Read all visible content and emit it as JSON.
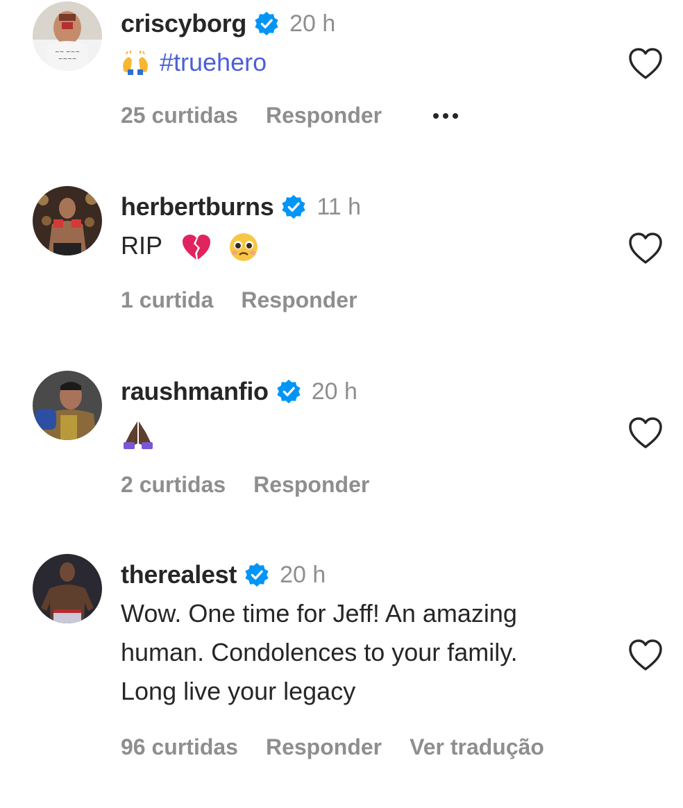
{
  "comments": [
    {
      "username": "criscyborg",
      "time": "20 h",
      "hashtag": "#truehero",
      "emoji": "raising-hands-emoji",
      "likes": "25 curtidas",
      "reply": "Responder",
      "more": "more-options"
    },
    {
      "username": "herbertburns",
      "time": "11 h",
      "text": "RIP",
      "emoji": [
        "broken-heart-emoji",
        "pleading-face-emoji"
      ],
      "likes": "1 curtida",
      "reply": "Responder"
    },
    {
      "username": "raushmanfio",
      "time": "20 h",
      "emoji": "folded-hands-emoji",
      "likes": "2 curtidas",
      "reply": "Responder"
    },
    {
      "username": "therealest",
      "time": "20 h",
      "text_lines": [
        "Wow. One time for Jeff! An amazing",
        "human. Condolences to your family.",
        "Long live your legacy"
      ],
      "likes": "96 curtidas",
      "reply": "Responder",
      "translate": "Ver tradução"
    }
  ],
  "colors": {
    "text": "#262626",
    "secondary": "#8e8e8e",
    "hashtag": "#4c5fd7",
    "verified": "#0095f6"
  }
}
